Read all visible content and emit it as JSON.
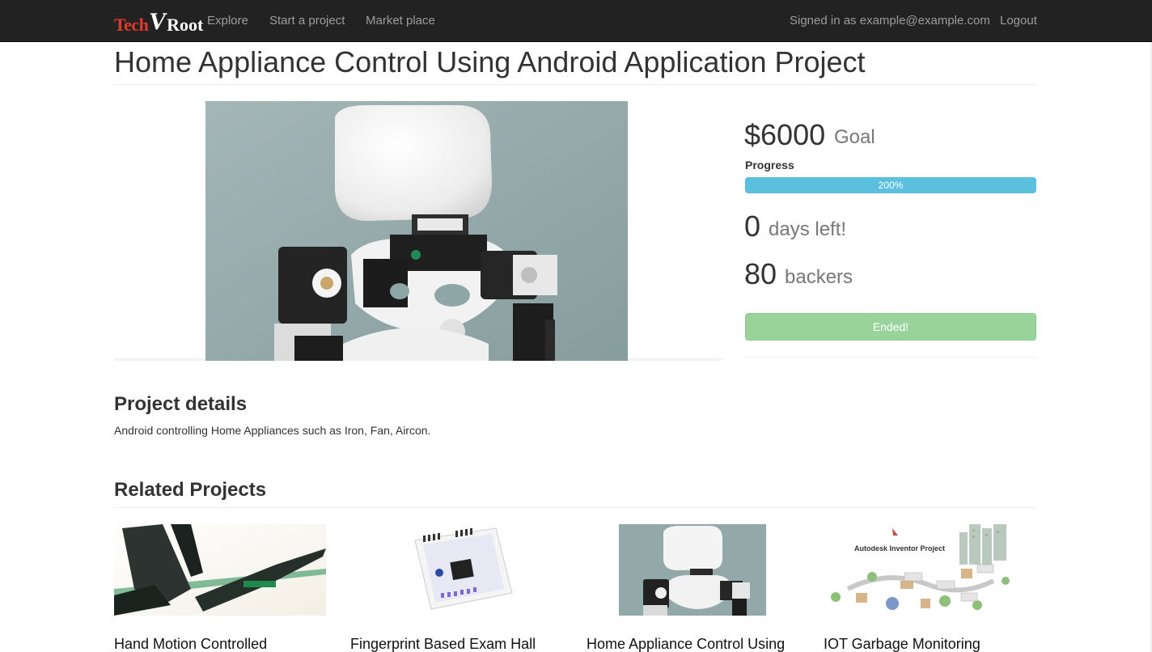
{
  "navbar": {
    "brand": {
      "part1": "Tech",
      "part2": "V",
      "part3": "Root"
    },
    "links": [
      "Explore",
      "Start a project",
      "Market place"
    ],
    "signed_in": "Signed in as example@example.com",
    "logout": "Logout"
  },
  "project": {
    "title": "Home Appliance Control Using Android Application Project",
    "goal_amount": "$6000",
    "goal_label": "Goal",
    "progress_label": "Progress",
    "progress_text": "200%",
    "progress_value": 1.0,
    "days_left_num": "0",
    "days_left_label": "days left!",
    "backers_num": "80",
    "backers_label": "backers",
    "status_button": "Ended!"
  },
  "details": {
    "heading": "Project details",
    "text": "Android controlling Home Appliances such as Iron, Fan, Aircon."
  },
  "related": {
    "heading": "Related Projects",
    "cards": [
      {
        "title": "Hand Motion Controlled"
      },
      {
        "title": "Fingerprint Based Exam Hall"
      },
      {
        "title": "Home Appliance Control Using"
      },
      {
        "title": "IOT Garbage Monitoring"
      }
    ]
  },
  "thumb_texts": {
    "autodesk": "Autodesk Inventor Project"
  },
  "colors": {
    "navbar_bg": "#222222",
    "brand_red": "#e03a2c",
    "progress_blue": "#5bc0de",
    "ended_green": "#98d39a"
  }
}
